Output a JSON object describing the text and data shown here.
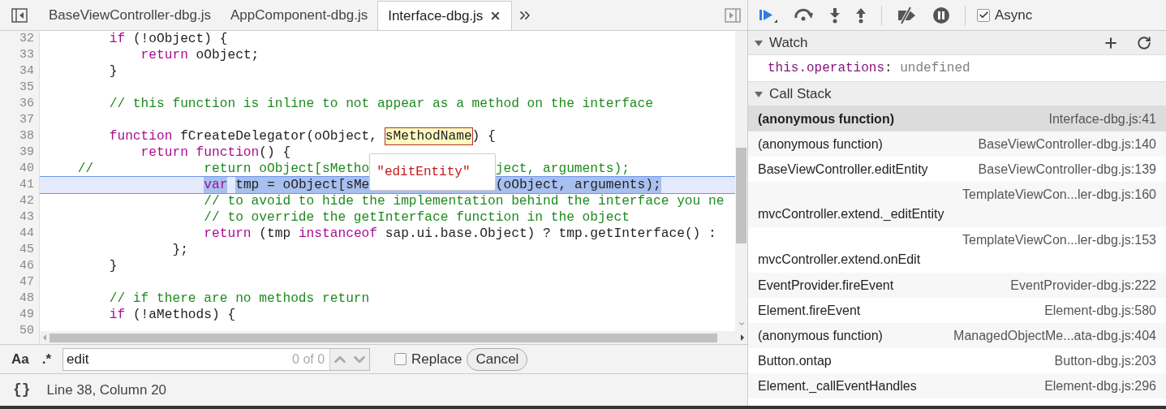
{
  "editor_tabs": [
    {
      "label": "BaseViewController-dbg.js",
      "selected": false
    },
    {
      "label": "AppComponent-dbg.js",
      "selected": false
    },
    {
      "label": "Interface-dbg.js",
      "selected": true
    }
  ],
  "code_lines": [
    {
      "number": "32",
      "current": false,
      "tokens": [
        {
          "kind": "keyword",
          "text": "        if"
        },
        {
          "kind": "plain",
          "text": " (!oObject) {"
        }
      ]
    },
    {
      "number": "33",
      "current": false,
      "tokens": [
        {
          "kind": "keyword",
          "text": "            return"
        },
        {
          "kind": "plain",
          "text": " oObject;"
        }
      ]
    },
    {
      "number": "34",
      "current": false,
      "tokens": [
        {
          "kind": "plain",
          "text": "        }"
        }
      ]
    },
    {
      "number": "35",
      "current": false
    },
    {
      "number": "36",
      "current": false,
      "tokens": [
        {
          "kind": "comment",
          "text": "        // this function is inline to not appear as a method on the interface"
        }
      ]
    },
    {
      "number": "37",
      "current": false
    },
    {
      "number": "38",
      "current": false,
      "tokens": [
        {
          "kind": "keyword",
          "text": "        function"
        },
        {
          "kind": "plain",
          "text": " fCreateDelegator(oObject, "
        },
        {
          "kind": "hover",
          "text": "sMethodName"
        },
        {
          "kind": "plain",
          "text": ") {"
        }
      ]
    },
    {
      "number": "39",
      "current": false,
      "tokens": [
        {
          "kind": "keyword",
          "text": "            return function"
        },
        {
          "kind": "plain",
          "text": "() {"
        }
      ]
    },
    {
      "number": "40",
      "current": false,
      "tokens": [
        {
          "kind": "comment",
          "text": "    //              return oObject[sMetho"
        },
        {
          "kind": "gap"
        },
        {
          "kind": "comment",
          "text": "ject, arguments);"
        }
      ]
    },
    {
      "number": "41",
      "current": true,
      "tokens": [
        {
          "kind": "keyword",
          "text": "                    var"
        },
        {
          "kind": "plain",
          "text": " tmp = oObject[sMe"
        },
        {
          "kind": "gap"
        },
        {
          "kind": "plain",
          "text": "(oObject, arguments);"
        }
      ]
    },
    {
      "number": "42",
      "current": false,
      "tokens": [
        {
          "kind": "comment",
          "text": "                    // to avoid to hide the implementation behind the interface you ne"
        }
      ]
    },
    {
      "number": "43",
      "current": false,
      "tokens": [
        {
          "kind": "comment",
          "text": "                    // to override the getInterface function in the object"
        }
      ]
    },
    {
      "number": "44",
      "current": false,
      "tokens": [
        {
          "kind": "keyword",
          "text": "                    return"
        },
        {
          "kind": "plain",
          "text": " (tmp "
        },
        {
          "kind": "keyword",
          "text": "instanceof"
        },
        {
          "kind": "plain",
          "text": " sap.ui.base.Object) ? tmp.getInterface() :"
        }
      ]
    },
    {
      "number": "45",
      "current": false,
      "tokens": [
        {
          "kind": "plain",
          "text": "                };"
        }
      ]
    },
    {
      "number": "46",
      "current": false,
      "tokens": [
        {
          "kind": "plain",
          "text": "        }"
        }
      ]
    },
    {
      "number": "47",
      "current": false
    },
    {
      "number": "48",
      "current": false,
      "tokens": [
        {
          "kind": "comment",
          "text": "        // if there are no methods return"
        }
      ]
    },
    {
      "number": "49",
      "current": false,
      "tokens": [
        {
          "kind": "keyword",
          "text": "        if"
        },
        {
          "kind": "plain",
          "text": " (!aMethods) {"
        }
      ]
    },
    {
      "number": "50",
      "current": false
    }
  ],
  "hover_popup": {
    "value": "\"editEntity\""
  },
  "search": {
    "case_toggle": "Aa",
    "regex_toggle": ".*",
    "query": "edit",
    "count": "0 of 0",
    "replace": {
      "label": "Replace",
      "checked": false
    },
    "cancel": "Cancel"
  },
  "status_bar": {
    "pretty_print": "{}",
    "position": "Line 38, Column 20"
  },
  "debug_toolbar": {
    "async": {
      "label": "Async",
      "checked": true
    }
  },
  "watch": {
    "title": "Watch",
    "expanded": true,
    "items": [
      {
        "expression": "this.operations",
        "separator": ":",
        "value": "undefined"
      }
    ]
  },
  "call_stack": {
    "title": "Call Stack",
    "expanded": true,
    "frames": [
      {
        "name": "(anonymous function)",
        "location": "Interface-dbg.js:41",
        "selected": true,
        "kind": "inline"
      },
      {
        "name": "(anonymous function)",
        "location": "BaseViewController-dbg.js:140",
        "selected": false,
        "kind": "inline"
      },
      {
        "name": "BaseViewController.editEntity",
        "location": "BaseViewController-dbg.js:139",
        "selected": false,
        "kind": "inline"
      },
      {
        "name": "mvcController.extend._editEntity",
        "location": "TemplateViewCon...ler-dbg.js:160",
        "selected": false,
        "kind": "stacked"
      },
      {
        "name": "mvcController.extend.onEdit",
        "location": "TemplateViewCon...ler-dbg.js:153",
        "selected": false,
        "kind": "stacked"
      },
      {
        "name": "EventProvider.fireEvent",
        "location": "EventProvider-dbg.js:222",
        "selected": false,
        "kind": "inline"
      },
      {
        "name": "Element.fireEvent",
        "location": "Element-dbg.js:580",
        "selected": false,
        "kind": "inline"
      },
      {
        "name": "(anonymous function)",
        "location": "ManagedObjectMe...ata-dbg.js:404",
        "selected": false,
        "kind": "inline"
      },
      {
        "name": "Button.ontap",
        "location": "Button-dbg.js:203",
        "selected": false,
        "kind": "inline"
      },
      {
        "name": "Element._callEventHandles",
        "location": "Element-dbg.js:296",
        "selected": false,
        "kind": "inline"
      }
    ]
  }
}
